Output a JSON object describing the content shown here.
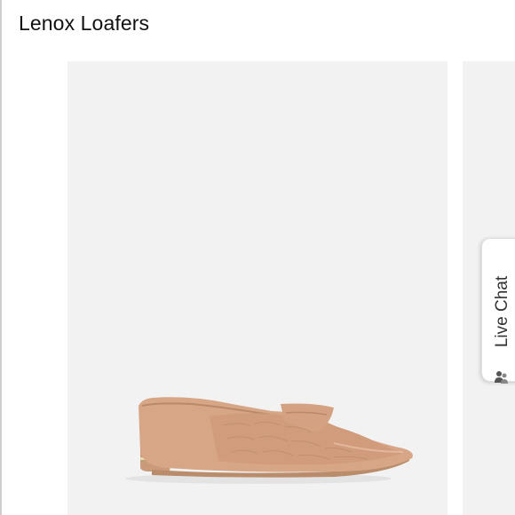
{
  "product": {
    "title": "Lenox Loafers"
  },
  "gallery": {
    "main_image": "loafer-product-photo",
    "panel_color": "#f2f2f2",
    "shoe_color": "#d7a686"
  },
  "live_chat": {
    "label": "Live Chat",
    "icon": "chat-people-icon"
  }
}
